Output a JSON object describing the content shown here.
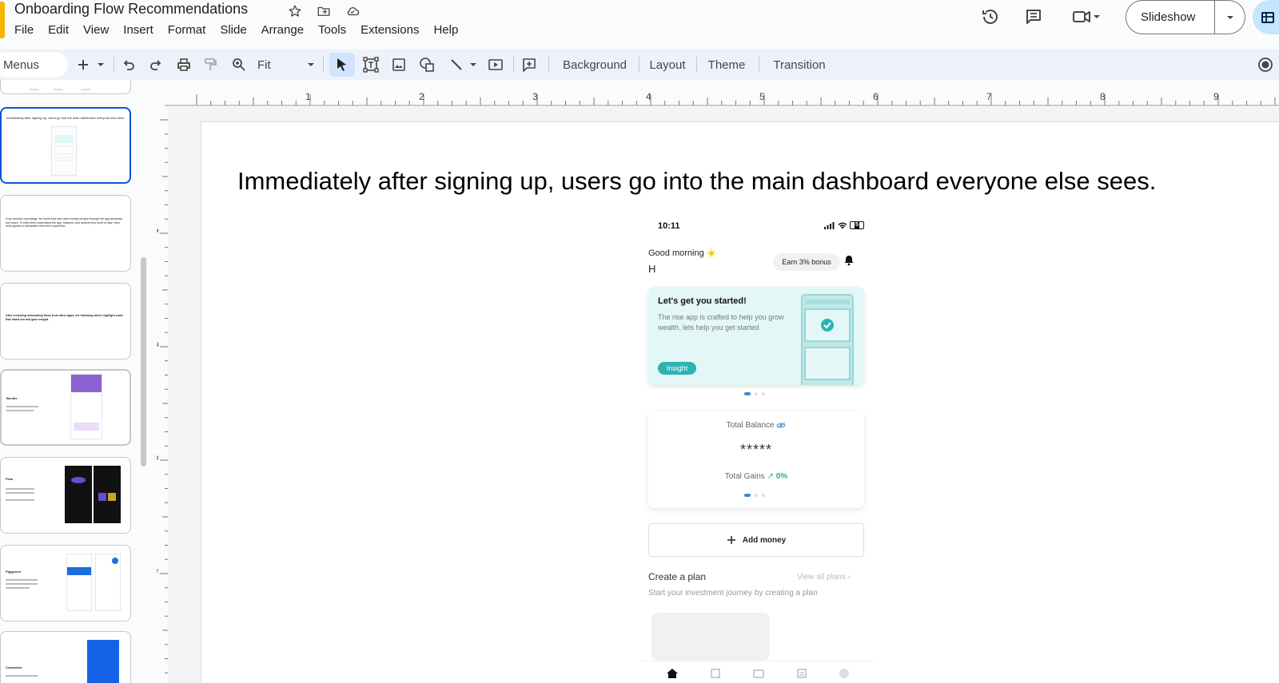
{
  "document": {
    "title": "Onboarding Flow Recommendations"
  },
  "menubar": [
    "File",
    "Edit",
    "View",
    "Insert",
    "Format",
    "Slide",
    "Arrange",
    "Tools",
    "Extensions",
    "Help"
  ],
  "header_right": {
    "slideshow_label": "Slideshow"
  },
  "toolbar": {
    "menus_label": "Menus",
    "zoom_value": "Fit",
    "background_label": "Background",
    "layout_label": "Layout",
    "theme_label": "Theme",
    "transition_label": "Transition"
  },
  "rulers": {
    "horizontal": [
      "1",
      "2",
      "3",
      "4",
      "5",
      "6",
      "7",
      "8",
      "9"
    ],
    "vertical": [
      "1",
      "2",
      "3",
      "4"
    ]
  },
  "filmstrip": {
    "thumbnails": [
      {
        "title": "Immediately after signing up, users go into the main dashboard everyone else sees."
      },
      {
        "title": "From session recordings, we found that new users simply browse through the app aimlessly and leave. To help them understand the app, features, and actions they need to take, they need guides to streamline their first experience."
      },
      {
        "title": "After reviewing onboarding flows from other apps, the following slides highlight some that stand out and gave insight."
      },
      {
        "title": "Bundle"
      },
      {
        "title": "Flow"
      },
      {
        "title": "Piggyvest"
      },
      {
        "title": "Cowrywise"
      }
    ]
  },
  "slide": {
    "heading": "Immediately after signing up, users go into the main dashboard everyone else sees.",
    "phone": {
      "time": "10:11",
      "battery": "5",
      "greeting": "Good morning",
      "user_initial": "H",
      "bonus_pill": "Earn 3% bonus",
      "card_title": "Let's get you started!",
      "card_body": "The rise app is crafted to help you grow wealth, lets help you get started",
      "insight_tag": "Insight",
      "balance_label": "Total Balance",
      "balance_value": "*****",
      "gains_label": "Total Gains",
      "gains_value": "0%",
      "add_money": "Add money",
      "plan_title": "Create a plan",
      "view_all": "View all plans",
      "plan_subtitle": "Start your investment journey by creating a plan"
    }
  },
  "colors": {
    "selection_blue": "#0b57d0",
    "toolbar_bg": "#edf2fa",
    "teal_accent": "#2bb3b1",
    "gain_green": "#2bb36b"
  }
}
